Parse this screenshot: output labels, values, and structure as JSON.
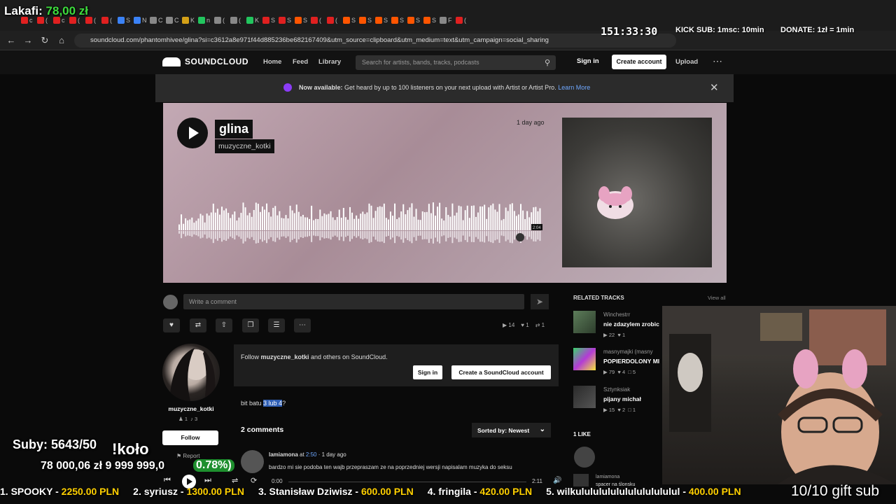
{
  "browser": {
    "tabs": [
      {
        "label": "c",
        "color": "#e02020"
      },
      {
        "label": "(",
        "color": "#e02020"
      },
      {
        "label": "c",
        "color": "#e02020"
      },
      {
        "label": "(",
        "color": "#e02020"
      },
      {
        "label": "(",
        "color": "#e02020"
      },
      {
        "label": "(",
        "color": "#e02020"
      },
      {
        "label": "S",
        "color": "#3b82f6"
      },
      {
        "label": "N",
        "color": "#3b82f6"
      },
      {
        "label": "C",
        "color": "#888888"
      },
      {
        "label": "C",
        "color": "#888888"
      },
      {
        "label": "K",
        "color": "#d4a017"
      },
      {
        "label": "n",
        "color": "#22c55e"
      },
      {
        "label": "(",
        "color": "#888888"
      },
      {
        "label": "(",
        "color": "#888888"
      },
      {
        "label": "K",
        "color": "#22c55e"
      },
      {
        "label": "S",
        "color": "#e02020"
      },
      {
        "label": "S",
        "color": "#e02020"
      },
      {
        "label": "S",
        "color": "#ff5500"
      },
      {
        "label": "(",
        "color": "#e02020"
      },
      {
        "label": "(",
        "color": "#e02020"
      },
      {
        "label": "S",
        "color": "#ff5500"
      },
      {
        "label": "S",
        "color": "#ff5500"
      },
      {
        "label": "S",
        "color": "#ff5500"
      },
      {
        "label": "S",
        "color": "#ff5500"
      },
      {
        "label": "S",
        "color": "#ff5500"
      },
      {
        "label": "S",
        "color": "#ff5500"
      },
      {
        "label": "F",
        "color": "#888888"
      },
      {
        "label": "(",
        "color": "#e02020"
      }
    ],
    "url": "soundcloud.com/phantomhivee/glina?si=c3612a8e971f44d885236be682167409&utm_source=clipboard&utm_medium=text&utm_campaign=social_sharing"
  },
  "header": {
    "logo": "SOUNDCLOUD",
    "nav": [
      "Home",
      "Feed",
      "Library"
    ],
    "search_placeholder": "Search for artists, bands, tracks, podcasts",
    "sign_in": "Sign in",
    "create_account": "Create account",
    "upload": "Upload"
  },
  "banner": {
    "bold": "Now available:",
    "text": " Get heard by up to 100 listeners on your next upload with Artist or Artist Pro.",
    "link": "Learn More"
  },
  "track": {
    "title": "glina",
    "artist": "muzyczne_kotki",
    "age": "1 day ago",
    "duration_badge": "2:04",
    "accent": "#ff5500"
  },
  "comment_box": {
    "placeholder": "Write a comment"
  },
  "stats": {
    "plays": "14",
    "likes": "1",
    "reposts": "1"
  },
  "artist_panel": {
    "name": "muzyczne_kotki",
    "followers": "1",
    "tracks": "3",
    "follow": "Follow",
    "report": "Report"
  },
  "follow_box": {
    "text_pre": "Follow ",
    "text_name": "muzyczne_kotki",
    "text_post": " and others on SoundCloud.",
    "sign_in": "Sign in",
    "create": "Create a SoundCloud account"
  },
  "description": {
    "pre": "bit batu ",
    "selected": "3 lub 4",
    "post": "?"
  },
  "comments": {
    "count_label": "2 comments",
    "sorted_label": "Sorted by: Newest",
    "items": [
      {
        "user": "lamiamona",
        "at": " at ",
        "time": "2:50",
        "age": " · 1 day ago",
        "text": "bardzo mi sie podoba ten wajb przepraszam ze na poprzedniej wersji napisalam muzyka do seksu"
      }
    ]
  },
  "related": {
    "heading": "RELATED TRACKS",
    "view_all": "View all",
    "items": [
      {
        "user": "Winchestrr",
        "title": "nie zdazylem zrobic",
        "plays": "22",
        "likes": "1",
        "comments": ""
      },
      {
        "user": "masnymajki (masny",
        "title": "POPIERDOLONY MI",
        "plays": "79",
        "likes": "4",
        "comments": "5"
      },
      {
        "user": "Sztynksiak",
        "title": "pijany michał",
        "plays": "15",
        "likes": "2",
        "comments": "1"
      }
    ]
  },
  "likes": {
    "heading": "1 LIKE",
    "user": "lamiamona",
    "track": "spacer na ślonsku"
  },
  "player": {
    "current": "0:00",
    "total": "2:11"
  },
  "overlay": {
    "lakafi_label": "Lakafi: ",
    "lakafi_amount": "78,00 zł",
    "timer": "151:33:30",
    "kick": "KICK SUB: 1msc: 10min",
    "donate": "DONATE: 1zł = 1min",
    "suby": "Suby: 5643/50",
    "kolo": "!koło",
    "money": "78 000,06 zł  9 999 999,0",
    "percent": "0.78%)",
    "ticker": [
      {
        "name": "1. SPOOKY - ",
        "amount": "2250.00 PLN"
      },
      {
        "name": "2. syriusz - ",
        "amount": "1300.00 PLN"
      },
      {
        "name": "3. Stanisław Dziwisz - ",
        "amount": "600.00 PLN"
      },
      {
        "name": "4. fringila - ",
        "amount": "420.00 PLN"
      },
      {
        "name": "5. wilkulululululululululululul - ",
        "amount": "400.00 PLN"
      }
    ],
    "gift": "10/10 gift sub"
  }
}
